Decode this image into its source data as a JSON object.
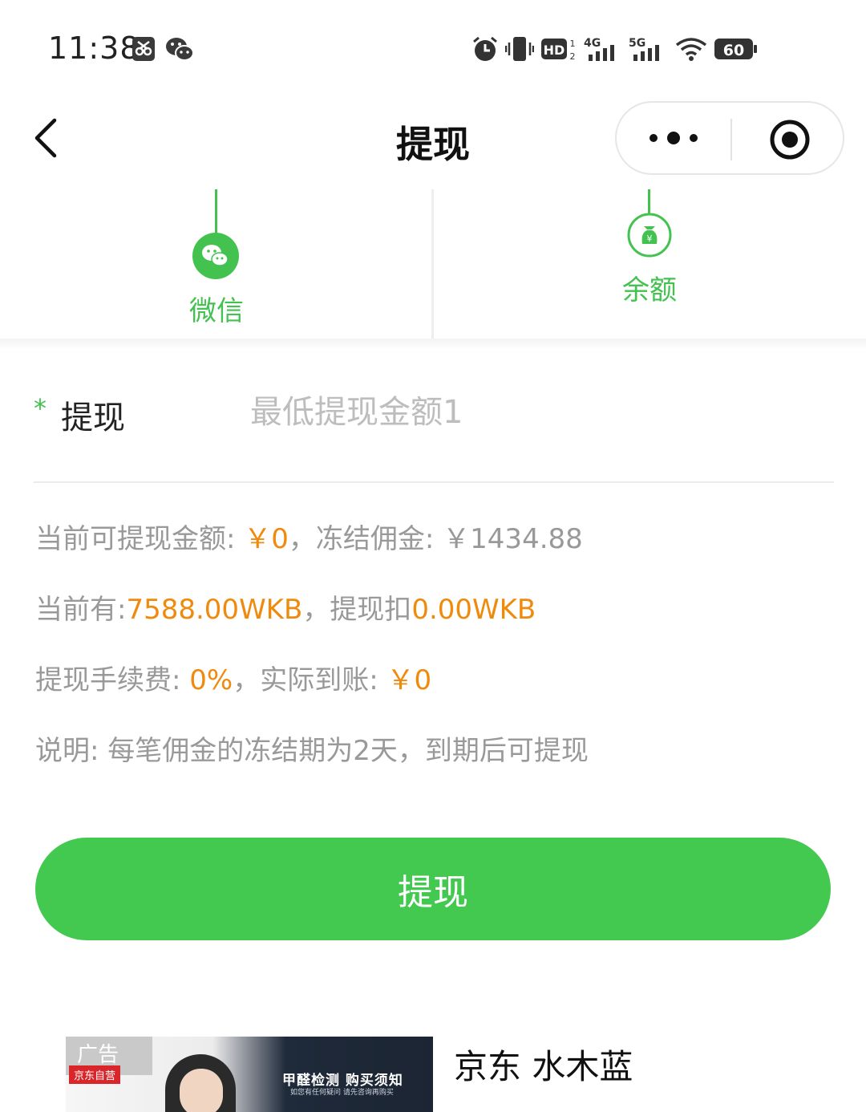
{
  "status_bar": {
    "time": "11:38",
    "battery": "60",
    "icons": [
      "screenshot-icon",
      "wechat-notification-icon",
      "alarm-icon",
      "vibrate-icon",
      "hd-icon",
      "signal-4g-icon",
      "signal-5g-icon",
      "wifi-icon",
      "battery-icon"
    ]
  },
  "nav": {
    "title": "提现",
    "back_icon": "chevron-left-icon",
    "menu_icon": "more-dots-icon",
    "close_icon": "record-icon"
  },
  "tabs": [
    {
      "label": "微信",
      "icon": "wechat-icon",
      "active": true
    },
    {
      "label": "余额",
      "icon": "money-bag-icon",
      "active": false
    }
  ],
  "form": {
    "required_mark": "*",
    "label": "提现",
    "value": "",
    "placeholder": "最低提现金额1"
  },
  "info": {
    "line1": {
      "prefix": "当前可提现金额: ",
      "available": "￥0",
      "middle": "，冻结佣金: ￥1434.88"
    },
    "line2": {
      "prefix": "当前有:",
      "balance": "7588.00WKB",
      "middle": "，提现扣",
      "deduct": "0.00WKB"
    },
    "line3": {
      "prefix": "提现手续费: ",
      "fee": "0%",
      "middle": "，实际到账: ",
      "actual": "￥0"
    },
    "line4": "说明: 每笔佣金的冻结期为2天，到期后可提现"
  },
  "submit_label": "提现",
  "ad": {
    "badge": "广告",
    "brand": "京东自营",
    "headline": "甲醛检测 购买须知",
    "subline": "如您有任何疑问 请先咨询再购买",
    "title": "京东 水木蓝"
  },
  "colors": {
    "accent_green": "#44c950",
    "highlight_orange": "#f08a0d",
    "muted_text": "#999999"
  }
}
